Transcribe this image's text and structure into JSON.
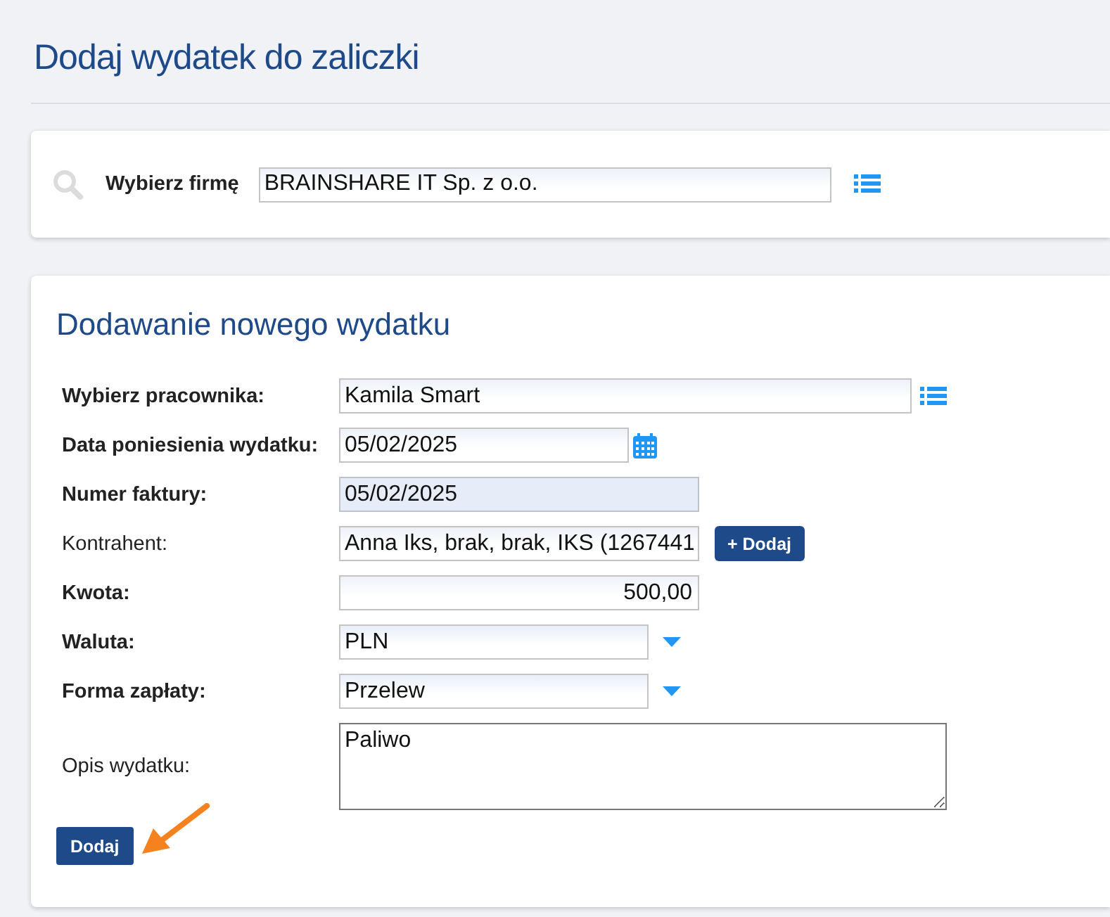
{
  "page_title": "Dodaj wydatek do zaliczki",
  "company_picker": {
    "label": "Wybierz firmę",
    "value": "BRAINSHARE IT Sp. z o.o."
  },
  "form": {
    "title": "Dodawanie nowego wydatku",
    "fields": [
      {
        "kind": "input",
        "label": "Wybierz pracownika:",
        "required": true,
        "value": "Kamila Smart",
        "readonly": false,
        "numeric": false,
        "addon": {
          "kind": "list"
        }
      },
      {
        "kind": "input",
        "label": "Data poniesienia wydatku:",
        "required": true,
        "value": "05/02/2025",
        "readonly": false,
        "numeric": false,
        "addon": {
          "kind": "calendar"
        }
      },
      {
        "kind": "input",
        "label": "Numer faktury:",
        "required": true,
        "value": "05/02/2025",
        "readonly": true,
        "numeric": false
      },
      {
        "kind": "input",
        "label": "Kontrahent:",
        "required": false,
        "value": "Anna Iks, brak, brak, IKS (1267441",
        "readonly": false,
        "numeric": false,
        "addon": {
          "kind": "button",
          "label": "+ Dodaj"
        }
      },
      {
        "kind": "input",
        "label": "Kwota:",
        "required": true,
        "value": "500,00",
        "readonly": false,
        "numeric": true
      },
      {
        "kind": "select",
        "label": "Waluta:",
        "required": true,
        "value": "PLN",
        "addon": {
          "kind": "dropdown"
        }
      },
      {
        "kind": "select",
        "label": "Forma zapłaty:",
        "required": true,
        "value": "Przelew",
        "addon": {
          "kind": "dropdown"
        }
      },
      {
        "kind": "textarea",
        "label": "Opis wydatku:",
        "required": false,
        "value": "Paliwo"
      }
    ],
    "submit": "Dodaj"
  }
}
